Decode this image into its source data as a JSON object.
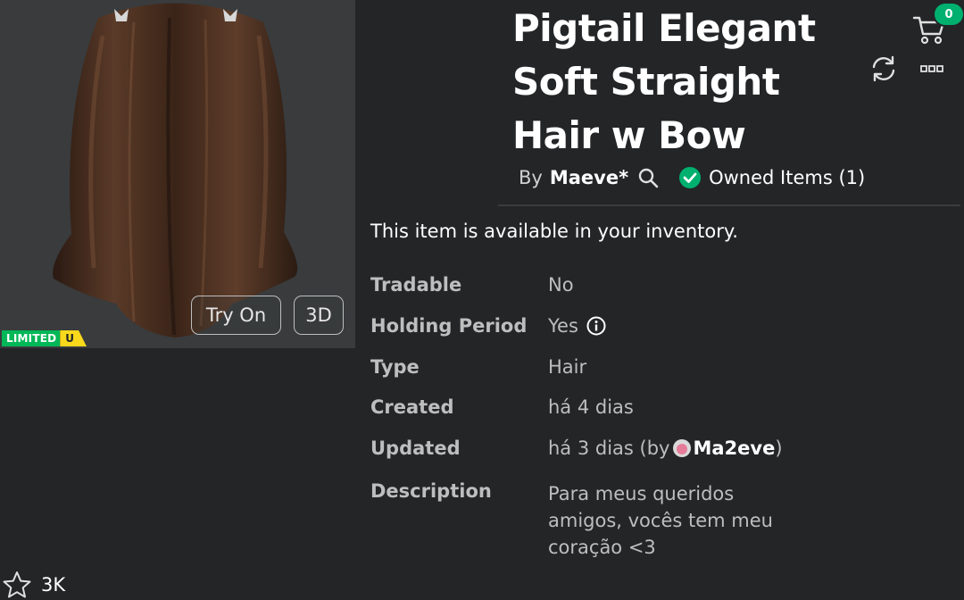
{
  "item": {
    "title": "Pigtail Elegant Soft Straight Hair w Bow",
    "by_label": "By",
    "creator": "Maeve*",
    "owned_label": "Owned Items (1)",
    "availability": "This item is available in your inventory."
  },
  "preview": {
    "try_on_label": "Try On",
    "view_3d_label": "3D",
    "limited_label": "LIMITED",
    "limited_u_label": "U"
  },
  "cart": {
    "count": "0"
  },
  "details": [
    {
      "key": "Tradable",
      "value": "No"
    },
    {
      "key": "Holding Period",
      "value": "Yes"
    },
    {
      "key": "Type",
      "value": "Hair"
    },
    {
      "key": "Created",
      "value": "há 4 dias"
    },
    {
      "key": "Updated",
      "value_prefix": "há 3 dias (by",
      "updater": "Ma2eve",
      "value_suffix": ")"
    },
    {
      "key": "Description",
      "value": "Para meus queridos amigos, vocês tem meu coração <3"
    }
  ],
  "favorites": {
    "count": "3K"
  },
  "colors": {
    "background": "#232527",
    "preview_bg": "#393b3d",
    "limited_green": "#02b757",
    "limited_yellow": "#f8d91c",
    "cart_badge": "#00b06f",
    "owned_check": "#00b06f"
  },
  "icons": [
    "cart-icon",
    "refresh-icon",
    "more-icon",
    "search-icon",
    "check-icon",
    "info-icon",
    "star-icon"
  ]
}
